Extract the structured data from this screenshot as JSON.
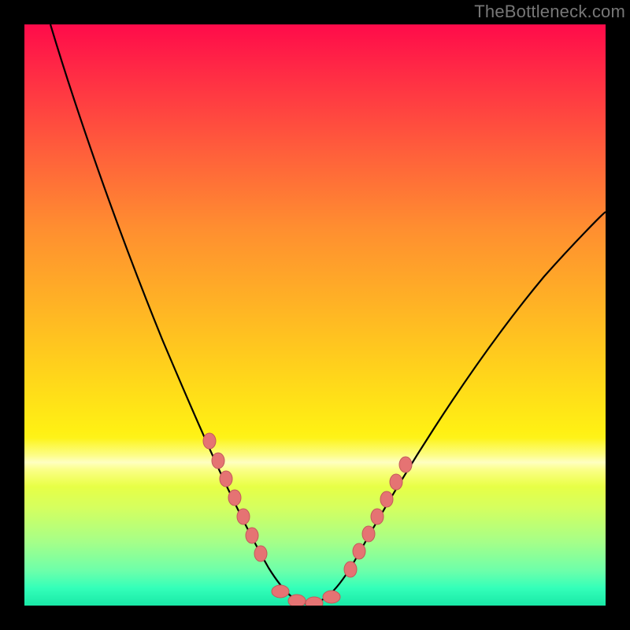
{
  "watermark": "TheBottleneck.com",
  "colors": {
    "point_fill": "#e57373",
    "point_stroke": "#c35a5a",
    "line": "#000000",
    "frame": "#000000"
  },
  "chart_data": {
    "type": "line",
    "title": "",
    "xlabel": "",
    "ylabel": "",
    "xlim": [
      0,
      100
    ],
    "ylim": [
      0,
      100
    ],
    "x": [
      0,
      5,
      10,
      15,
      20,
      25,
      30,
      35,
      38,
      40,
      42,
      44,
      46,
      48,
      50,
      52,
      54,
      56,
      60,
      65,
      70,
      75,
      80,
      85,
      90,
      95,
      100
    ],
    "y": [
      100,
      90,
      79,
      67,
      55,
      42,
      30,
      18,
      11,
      8,
      5,
      3,
      1.5,
      0.7,
      0.3,
      1,
      3,
      6,
      13,
      22,
      31,
      39,
      46,
      52,
      58,
      63,
      67
    ],
    "note": "y is qualitative height of curve (percent of plot height), estimated from pixels",
    "marker_clusters": [
      {
        "side": "left",
        "x": [
          30,
          31.5,
          33,
          34.5,
          36,
          37.5,
          39
        ],
        "y": [
          30,
          27,
          24,
          21,
          17,
          13,
          10
        ]
      },
      {
        "side": "bottom",
        "x": [
          43,
          46,
          49,
          52
        ],
        "y": [
          2.5,
          1,
          0.6,
          1.3
        ]
      },
      {
        "side": "right",
        "x": [
          55,
          56.5,
          58,
          59.5,
          61,
          62.5,
          64
        ],
        "y": [
          6,
          8,
          11,
          14,
          17,
          20,
          23
        ]
      }
    ]
  }
}
